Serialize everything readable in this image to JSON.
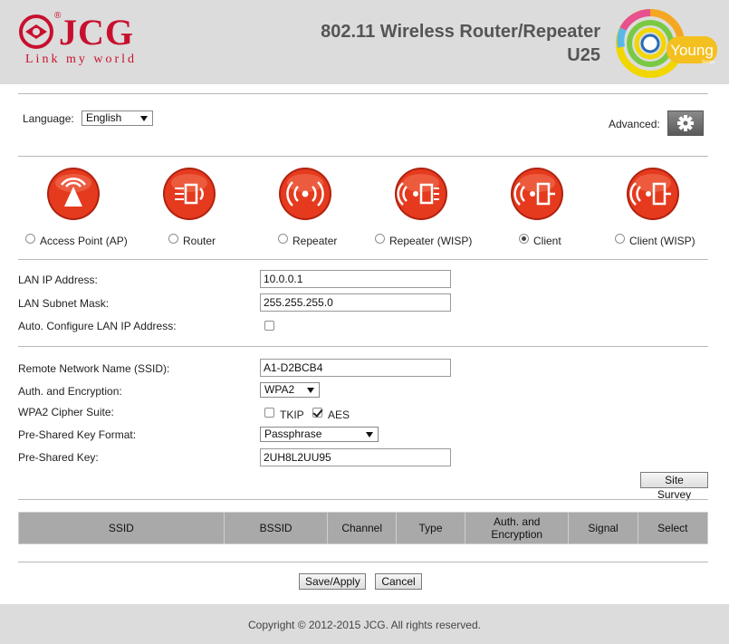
{
  "header": {
    "brand": "JCG",
    "registered": "®",
    "slogan": "Link my world",
    "product_title": "802.11 Wireless Router/Repeater",
    "model": "U25",
    "badge_text": "Young",
    "badge_sub": "Series",
    "brand_color": "#c8102e"
  },
  "language": {
    "label": "Language:",
    "selected": "English"
  },
  "advanced": {
    "label": "Advanced:",
    "icon": "gear-icon"
  },
  "modes": [
    {
      "label": "Access Point (AP)",
      "icon": "access-point-icon",
      "selected": false
    },
    {
      "label": "Router",
      "icon": "router-icon",
      "selected": false
    },
    {
      "label": "Repeater",
      "icon": "repeater-icon",
      "selected": false
    },
    {
      "label": "Repeater (WISP)",
      "icon": "repeater-wisp-icon",
      "selected": false
    },
    {
      "label": "Client",
      "icon": "client-icon",
      "selected": true
    },
    {
      "label": "Client (WISP)",
      "icon": "client-wisp-icon",
      "selected": false
    }
  ],
  "lan": {
    "ip_label": "LAN IP Address:",
    "ip_value": "10.0.0.1",
    "mask_label": "LAN Subnet Mask:",
    "mask_value": "255.255.255.0",
    "auto_label": "Auto. Configure LAN IP Address:",
    "auto_checked": false
  },
  "wireless": {
    "ssid_label": "Remote Network Name (SSID):",
    "ssid_value": "A1-D2BCB4",
    "auth_label": "Auth. and Encryption:",
    "auth_value": "WPA2",
    "cipher_label": "WPA2 Cipher Suite:",
    "tkip_label": "TKIP",
    "tkip_checked": false,
    "aes_label": "AES",
    "aes_checked": true,
    "format_label": "Pre-Shared Key Format:",
    "format_value": "Passphrase",
    "key_label": "Pre-Shared Key:",
    "key_value": "2UH8L2UU95"
  },
  "site_survey_button": "Site Survey",
  "survey_table": {
    "columns": [
      "SSID",
      "BSSID",
      "Channel",
      "Type",
      "Auth. and Encryption",
      "Signal",
      "Select"
    ]
  },
  "actions": {
    "save": "Save/Apply",
    "cancel": "Cancel"
  },
  "footer": {
    "copyright": "Copyright © 2012-2015 JCG. All rights reserved."
  },
  "colors": {
    "icon_red": "#e53a1e",
    "header_bg": "#dcdcdc",
    "table_header_bg": "#a9a9a9"
  }
}
